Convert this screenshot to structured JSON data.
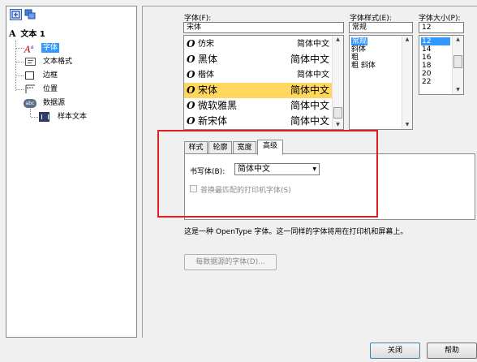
{
  "tree": {
    "root_label": "文本 1",
    "items": [
      {
        "label": "字体",
        "icon": "font-icon"
      },
      {
        "label": "文本格式",
        "icon": "text-format-icon"
      },
      {
        "label": "边框",
        "icon": "border-icon"
      },
      {
        "label": "位置",
        "icon": "position-icon"
      },
      {
        "label": "数据源",
        "icon": "datasource-icon"
      },
      {
        "label": "样本文本",
        "icon": "sample-text-icon"
      }
    ]
  },
  "font": {
    "label": "字体(F):",
    "value": "宋体",
    "list": [
      {
        "name": "仿宋",
        "script": "简体中文"
      },
      {
        "name": "黑体",
        "script": "简体中文"
      },
      {
        "name": "楷体",
        "script": "简体中文"
      },
      {
        "name": "宋体",
        "script": "简体中文"
      },
      {
        "name": "微软雅黑",
        "script": "简体中文"
      },
      {
        "name": "新宋体",
        "script": "简体中文"
      }
    ],
    "selected_index": 3
  },
  "style": {
    "label": "字体样式(E):",
    "value": "常规",
    "list": [
      "常规",
      "斜体",
      "粗",
      "粗 斜体"
    ],
    "selected_index": 0
  },
  "size": {
    "label": "字体大小(P):",
    "value": "12",
    "list": [
      "12",
      "14",
      "16",
      "18",
      "20",
      "22"
    ],
    "selected_index": 0
  },
  "tabs": {
    "items": [
      "样式",
      "轮廓",
      "宽度",
      "高级"
    ],
    "active_index": 3
  },
  "advanced": {
    "script_label": "书写体(B):",
    "script_value": "简体中文",
    "checkbox_label": "普换最匹配的打印机字体(S)",
    "checkbox_checked": false
  },
  "description": "这是一种 OpenType 字体。这一同样的字体将用在打印机和屏幕上。",
  "buttons": {
    "datasource_font": "每数据源的字体(D)...",
    "close": "关闭",
    "help": "帮助"
  },
  "colors": {
    "selection": "#3399ff",
    "highlight_row": "#ffd75e",
    "annotation": "#e02020"
  }
}
